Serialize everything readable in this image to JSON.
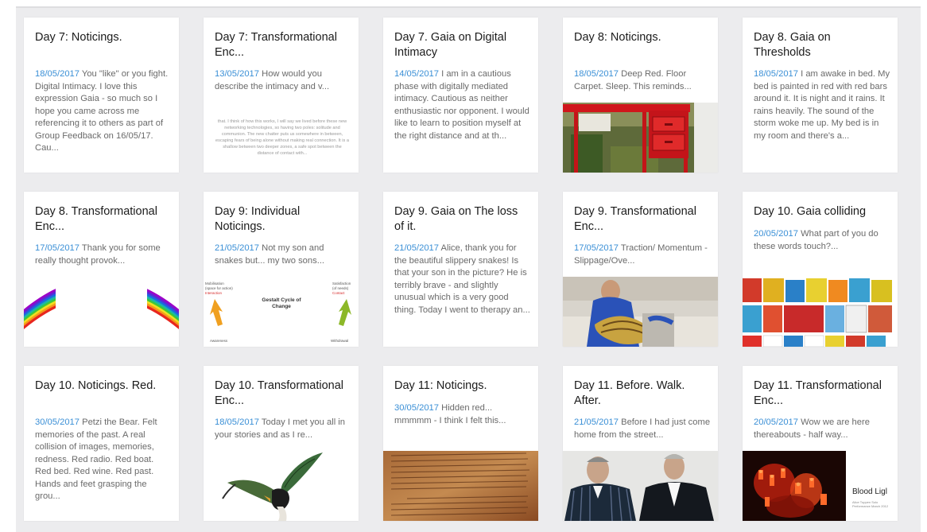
{
  "colors": {
    "date": "#3a8fd6",
    "title": "#1b1b1b",
    "excerpt": "#6a6a6a",
    "background": "#ececee"
  },
  "cards": [
    {
      "title": "Day 7: Noticings.",
      "date": "18/05/2017",
      "text": " You \"like\" or you fight. Digital Intimacy. I love this expression Gaia - so much so I hope you came across me referencing it to others as part of Group Feedback on 16/05/17. Cau..."
    },
    {
      "title": "Day 7: Transformational Enc...",
      "date": "13/05/2017",
      "text": " How would you describe the intimacy and v...",
      "doc_lines": "that. I think of how this works, I will say we lived before these new networking technologies, so having two poles: solitude and communion. The new chatter puts us somewhere in between, escaping fears of being alone without making real connection. It is a shallow between two deeper zones, a safe spot between the distance of contact with..."
    },
    {
      "title": "Day 7. Gaia on Digital Intimacy",
      "date": "14/05/2017",
      "text": " I am in a cautious phase with digitally mediated intimacy. Cautious as neither enthusiastic nor opponent. I would like to learn to position myself at the right distance and at th..."
    },
    {
      "title": "Day 8: Noticings.",
      "date": "18/05/2017",
      "text": " Deep Red. Floor Carpet. Sleep. This reminds..."
    },
    {
      "title": "Day 8. Gaia on Thresholds",
      "date": "18/05/2017",
      "text": " I am awake in bed. My bed is painted in red with red bars around it. It is night and it rains. It rains heavily. The sound of the storm woke me up. My bed is in my room and there's a..."
    },
    {
      "title": "Day 8. Transformational Enc...",
      "date": "17/05/2017",
      "text": " Thank you for some really thought provok..."
    },
    {
      "title": "Day 9: Individual Noticings.",
      "date": "21/05/2017",
      "text": " Not my son and snakes but... my two sons...",
      "gestalt": {
        "center": "Gestalt Cycle of Change",
        "left_top": "Mobilisation",
        "left_sub": "(space for action)",
        "left_red": "Interaction",
        "right_top": "Satisfaction",
        "right_sub": "(of needs)",
        "right_red": "Contact",
        "left_bottom": "Awareness",
        "right_bottom": "Withdrawal"
      }
    },
    {
      "title": "Day 9. Gaia on The loss of it.",
      "date": "21/05/2017",
      "text": " Alice, thank you for the beautiful slippery snakes! Is that your son in the picture? He is terribly brave - and slightly unusual which is a very good thing. Today I went to therapy an..."
    },
    {
      "title": "Day 9. Transformational Enc...",
      "date": "17/05/2017",
      "text": " Traction/ Momentum - Slippage/Ove..."
    },
    {
      "title": "Day 10. Gaia colliding",
      "date": "20/05/2017",
      "text": " What part of you do these words touch?..."
    },
    {
      "title": "Day 10. Noticings. Red.",
      "date": "30/05/2017",
      "text": " Petzi the Bear. Felt memories of the past. A real collision of images, memories, redness. Red radio. Red boat. Red bed. Red wine. Red past. Hands and feet grasping the grou..."
    },
    {
      "title": "Day 10. Transformational Enc...",
      "date": "18/05/2017",
      "text": " Today I met you all in your stories and as I re..."
    },
    {
      "title": "Day 11: Noticings.",
      "date": "30/05/2017",
      "text": " Hidden red... mmmmm - I think I felt this..."
    },
    {
      "title": "Day 11. Before. Walk. After.",
      "date": "21/05/2017",
      "text": " Before I had just come home from the street..."
    },
    {
      "title": "Day 11. Transformational Enc...",
      "date": "20/05/2017",
      "text": " Wow we are here thereabouts - half way...",
      "blood": {
        "title": "Blood Ligl",
        "sub": "Alice Tuppen Solo Performance March 2012"
      }
    }
  ]
}
